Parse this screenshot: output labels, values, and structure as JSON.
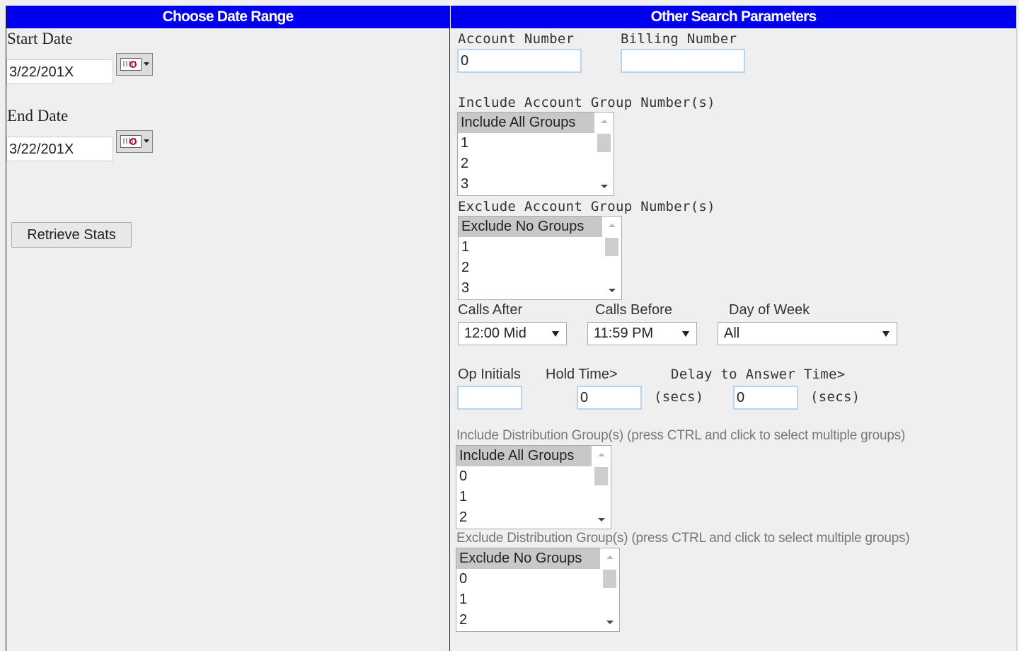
{
  "left": {
    "header": "Choose Date Range",
    "start_label": "Start Date",
    "start_value": "3/22/201X",
    "end_label": "End Date",
    "end_value": "3/22/201X",
    "retrieve_button": "Retrieve Stats"
  },
  "right": {
    "header": "Other Search Parameters",
    "account_number_label": "Account Number",
    "account_number_value": "0",
    "billing_number_label": "Billing Number",
    "billing_number_value": "",
    "include_acct_label": "Include Account Group Number(s)",
    "include_acct_options": [
      "Include All Groups",
      "1",
      "2",
      "3"
    ],
    "exclude_acct_label": "Exclude Account Group Number(s)",
    "exclude_acct_options": [
      "Exclude No Groups",
      "1",
      "2",
      "3"
    ],
    "calls_after_label": "Calls After",
    "calls_after_value": "12:00 Mid",
    "calls_before_label": "Calls Before",
    "calls_before_value": "11:59 PM",
    "day_of_week_label": "Day of Week",
    "day_of_week_value": "All",
    "op_initials_label": "Op Initials",
    "op_initials_value": "",
    "hold_time_label": "Hold Time>",
    "hold_time_value": "0",
    "secs_label": "(secs)",
    "delay_label": "Delay to Answer Time>",
    "delay_value": "0",
    "secs_label_2": "(secs)",
    "include_dist_label": "Include Distribution Group(s) (press CTRL and click to select multiple groups)",
    "include_dist_options": [
      "Include All Groups",
      "0",
      "1",
      "2"
    ],
    "exclude_dist_label": "Exclude Distribution Group(s) (press CTRL and click to select multiple groups)",
    "exclude_dist_options": [
      "Exclude No Groups",
      "0",
      "1",
      "2"
    ]
  },
  "icons": {
    "calendar": "calendar-icon"
  },
  "colors": {
    "header_bg": "#0000ee",
    "header_text": "#ffffff",
    "page_bg": "#efefef"
  }
}
